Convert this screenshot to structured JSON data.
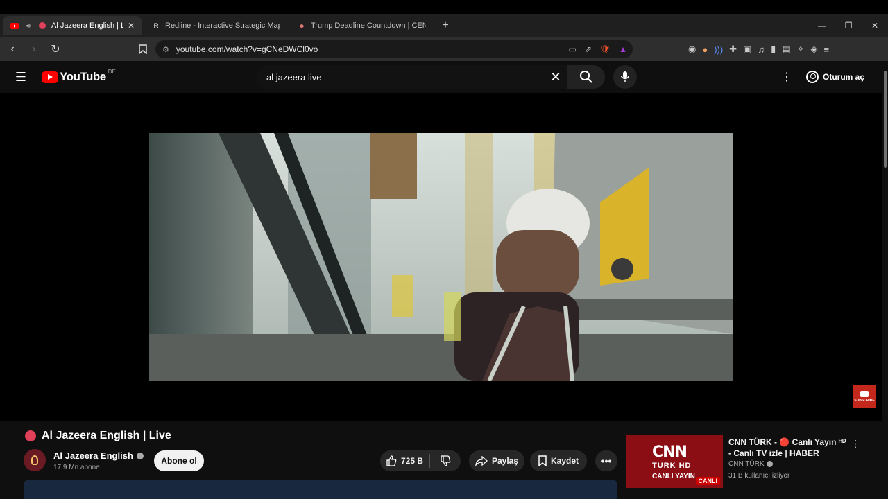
{
  "browser": {
    "tabs": [
      {
        "title": "Al Jazeera English | Live -",
        "active": true,
        "close": "✕"
      },
      {
        "title": "Redline - Interactive Strategic Map",
        "active": false
      },
      {
        "title": "Trump Deadline Countdown | CENTCO",
        "active": false
      }
    ],
    "new_tab": "+",
    "address": "youtube.com/watch?v=gCNeDWCl0vo"
  },
  "youtube": {
    "logo_text": "YouTube",
    "region": "DE",
    "search_query": "al jazeera live",
    "signin_label": "Oturum aç"
  },
  "video": {
    "title": "Al Jazeera English | Live",
    "channel": "Al Jazeera English",
    "subscribers": "17,9 Mn abone",
    "subscribe_label": "Abone ol",
    "likes": "725 B",
    "share_label": "Paylaş",
    "save_label": "Kaydet",
    "watermark_text": "SUBSCRIBE"
  },
  "recommended": {
    "title": "CNN TÜRK - 🔴 Canlı Yayın ᴴᴰ - Canlı TV izle | HABER",
    "channel": "CNN TÜRK",
    "viewers": "31 B kullanıcı izliyor",
    "thumb_brand": "CNN",
    "thumb_sub": "TURK HD",
    "thumb_live": "CANLI YAYIN",
    "badge": "CANLI"
  },
  "colors": {
    "yt_red": "#ff0000",
    "live_dot": "#e0405a",
    "background": "#0f0f0f"
  }
}
